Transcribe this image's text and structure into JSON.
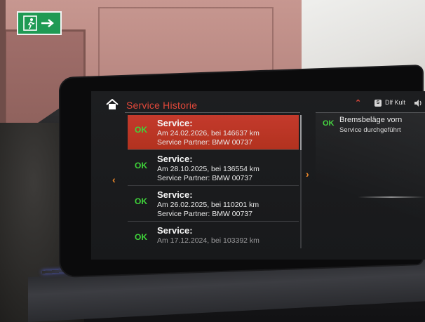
{
  "screen": {
    "title": "Service Historie",
    "header_right": {
      "mode_badge": "S",
      "mode_label": "Dlf Kult"
    },
    "items": [
      {
        "status": "OK",
        "heading": "Service:",
        "date_km": "Am 24.02.2026, bei 146637 km",
        "partner": "Service Partner: BMW 00737",
        "selected": true
      },
      {
        "status": "OK",
        "heading": "Service:",
        "date_km": "Am 28.10.2025, bei 136554 km",
        "partner": "Service Partner: BMW 00737",
        "selected": false
      },
      {
        "status": "OK",
        "heading": "Service:",
        "date_km": "Am 26.02.2025, bei 110201 km",
        "partner": "Service Partner: BMW 00737",
        "selected": false
      },
      {
        "status": "OK",
        "heading": "Service:",
        "date_km": "Am 17.12.2024, bei 103392 km",
        "partner": "",
        "selected": false
      }
    ],
    "detail": {
      "status": "OK",
      "title": "Bremsbeläge vorn",
      "subtitle": "Service durchgeführt"
    },
    "colors": {
      "accent": "#e0483a",
      "ok": "#3fd43a",
      "selected_row": "#c43a2c",
      "chevron": "#f08a2a"
    },
    "icons": {
      "home": "home-icon",
      "left": "chevron-left-icon",
      "right": "chevron-right-icon",
      "up": "chevron-up-icon",
      "speaker": "speaker-icon"
    }
  }
}
